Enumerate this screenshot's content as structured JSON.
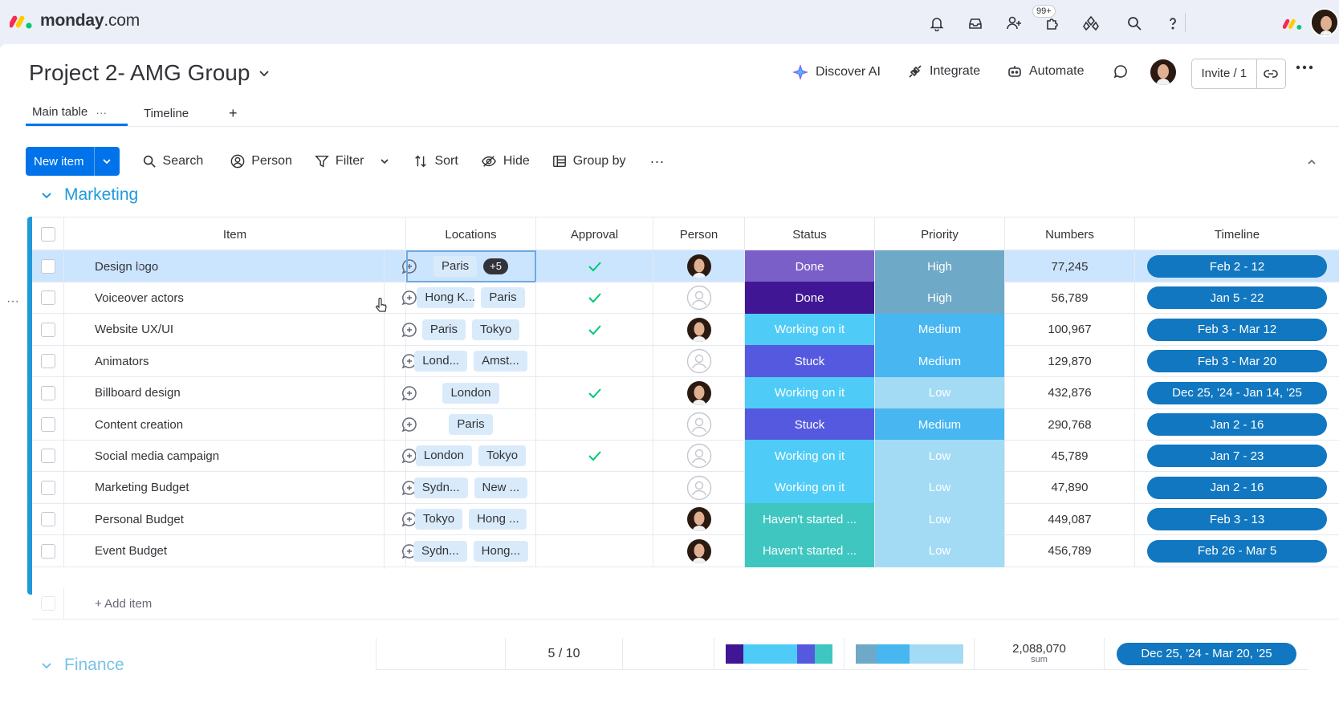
{
  "app": {
    "logo_brand": "monday",
    "logo_suffix": ".com",
    "notification_badge": "99+"
  },
  "board": {
    "title": "Project 2- AMG Group"
  },
  "header_actions": {
    "discover_ai": "Discover AI",
    "integrate": "Integrate",
    "automate": "Automate",
    "invite": "Invite / 1"
  },
  "tabs": [
    {
      "label": "Main table"
    },
    {
      "label": "Timeline"
    }
  ],
  "tabs_add": "+",
  "toolbar": {
    "new_item": "New item",
    "search": "Search",
    "person": "Person",
    "filter": "Filter",
    "sort": "Sort",
    "hide": "Hide",
    "group_by": "Group by"
  },
  "group": {
    "title": "Marketing"
  },
  "columns": {
    "item": "Item",
    "locations": "Locations",
    "approval": "Approval",
    "person": "Person",
    "status": "Status",
    "priority": "Priority",
    "numbers": "Numbers",
    "timeline": "Timeline"
  },
  "colors": {
    "Done": "#7b5fc9",
    "Done_dark": "#401694",
    "Working on it": "#4eccf7",
    "Stuck": "#5559df",
    "Haven't started ...": "#3fc6c0",
    "High": "#6fa9c8",
    "Medium": "#47b6f1",
    "Low": "#a3dbf4",
    "accent": "#0073ea",
    "group": "#1f9ad8"
  },
  "rows": [
    {
      "name": "Design logo",
      "locations": [
        "Paris"
      ],
      "more": "+5",
      "approved": true,
      "person": "photo",
      "status": "Done",
      "status_tone": "light",
      "priority": "High",
      "number": "77,245",
      "timeline": "Feb 2 - 12",
      "selected": true
    },
    {
      "name": "Voiceover actors",
      "locations": [
        "Hong K...",
        "Paris"
      ],
      "approved": true,
      "person": "empty",
      "status": "Done",
      "status_tone": "dark",
      "priority": "High",
      "number": "56,789",
      "timeline": "Jan 5 - 22"
    },
    {
      "name": "Website UX/UI",
      "locations": [
        "Paris",
        "Tokyo"
      ],
      "approved": true,
      "person": "photo",
      "status": "Working on it",
      "priority": "Medium",
      "number": "100,967",
      "timeline": "Feb 3 - Mar 12"
    },
    {
      "name": "Animators",
      "locations": [
        "Lond...",
        "Amst..."
      ],
      "approved": false,
      "person": "empty",
      "status": "Stuck",
      "priority": "Medium",
      "number": "129,870",
      "timeline": "Feb 3 - Mar 20"
    },
    {
      "name": "Billboard design",
      "locations": [
        "London"
      ],
      "approved": true,
      "person": "photo",
      "status": "Working on it",
      "priority": "Low",
      "number": "432,876",
      "timeline": "Dec 25, '24 - Jan 14, '25"
    },
    {
      "name": "Content creation",
      "locations": [
        "Paris"
      ],
      "approved": false,
      "person": "empty",
      "status": "Stuck",
      "priority": "Medium",
      "number": "290,768",
      "timeline": "Jan 2 - 16"
    },
    {
      "name": "Social media campaign",
      "locations": [
        "London",
        "Tokyo"
      ],
      "approved": true,
      "person": "empty",
      "status": "Working on it",
      "priority": "Low",
      "number": "45,789",
      "timeline": "Jan 7 - 23"
    },
    {
      "name": "Marketing Budget",
      "locations": [
        "Sydn...",
        "New ..."
      ],
      "approved": false,
      "person": "empty",
      "status": "Working on it",
      "priority": "Low",
      "number": "47,890",
      "timeline": "Jan 2 - 16"
    },
    {
      "name": "Personal Budget",
      "locations": [
        "Tokyo",
        "Hong ..."
      ],
      "approved": false,
      "person": "photo",
      "status": "Haven't started ...",
      "priority": "Low",
      "number": "449,087",
      "timeline": "Feb 3 - 13"
    },
    {
      "name": "Event Budget",
      "locations": [
        "Sydn...",
        "Hong..."
      ],
      "approved": false,
      "person": "photo",
      "status": "Haven't started ...",
      "priority": "Low",
      "number": "456,789",
      "timeline": "Feb 26 - Mar 5"
    }
  ],
  "add_item": "+ Add item",
  "summary": {
    "approval": "5 / 10",
    "numbers_sum": "2,088,070",
    "numbers_label": "sum",
    "timeline": "Dec 25, '24 - Mar 20, '25"
  },
  "next_group": {
    "title": "Finance"
  }
}
